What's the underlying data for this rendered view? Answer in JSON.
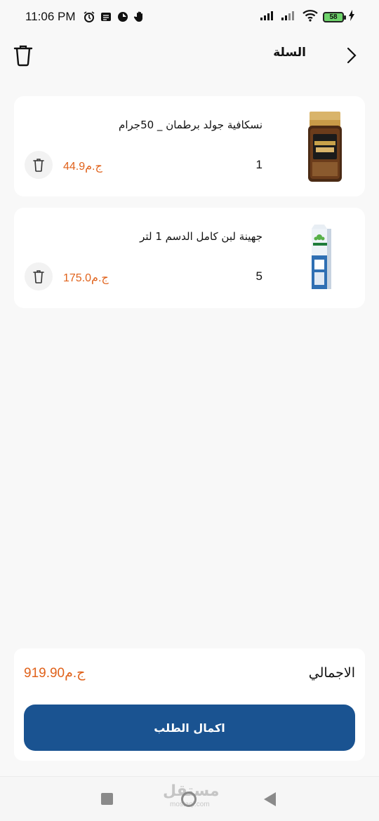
{
  "status_bar": {
    "time": "11:06 PM",
    "battery": "58"
  },
  "header": {
    "title": "السلة"
  },
  "cart": {
    "items": [
      {
        "name": "نسكافية جولد برطمان _ 50جرام",
        "quantity": "1",
        "price": "44.9ج.م"
      },
      {
        "name": "جهينة لبن كامل الدسم 1 لتر",
        "quantity": "5",
        "price": "175.0ج.م"
      }
    ]
  },
  "summary": {
    "total_label": "الاجمالي",
    "total_value": "919.90ج.م",
    "checkout_label": "اكمال الطلب"
  },
  "watermark": {
    "text": "مستقل",
    "sub": "mostaql.com"
  },
  "colors": {
    "accent": "#1a5391",
    "price": "#e0621b"
  }
}
